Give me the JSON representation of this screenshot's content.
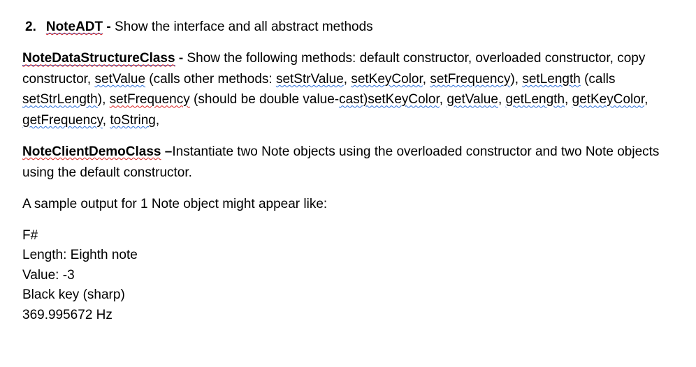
{
  "item2": {
    "number": "2.",
    "title": "NoteADT",
    "dash": " - ",
    "desc": "Show the interface and all abstract methods"
  },
  "p2": {
    "title": "NoteDataStructureClass",
    "dash": " - ",
    "t1": "Show the following methods: default constructor, overloaded constructor, copy constructor, ",
    "m_setValue": "setValue",
    "t2": " (calls other methods: ",
    "m_setStrValue": "setStrValue",
    "t3": ", ",
    "m_setKeyColor": "setKeyColor",
    "t4": ", ",
    "m_setFrequency": "setFrequency",
    "t5": "), ",
    "m_setLength": "setLength",
    "t6": " (calls ",
    "m_setStrLength": "setStrLength",
    "t7": "), ",
    "m_setFrequency2": "setFrequency",
    "t8": " (should be double value-",
    "m_cast": "cast)setKeyColor",
    "t9": ", ",
    "m_getValue": "getValue",
    "t10": ", ",
    "m_getLength": "getLength",
    "t11": ", ",
    "m_getKeyColor": "getKeyColor",
    "t12": ", ",
    "m_getFrequency": "getFrequency",
    "t13": ", ",
    "m_toString": "toString",
    "t14": ","
  },
  "p3": {
    "title": "NoteClientDemoClass",
    "dash": " –",
    "body": "Instantiate two Note objects using the overloaded constructor and two Note objects using the default constructor."
  },
  "p4": "A sample output for 1 Note object might appear like:",
  "sample": {
    "l1": "F#",
    "l2": "Length: Eighth note",
    "l3": "Value: -3",
    "l4": "Black key (sharp)",
    "l5": "369.995672 Hz"
  }
}
